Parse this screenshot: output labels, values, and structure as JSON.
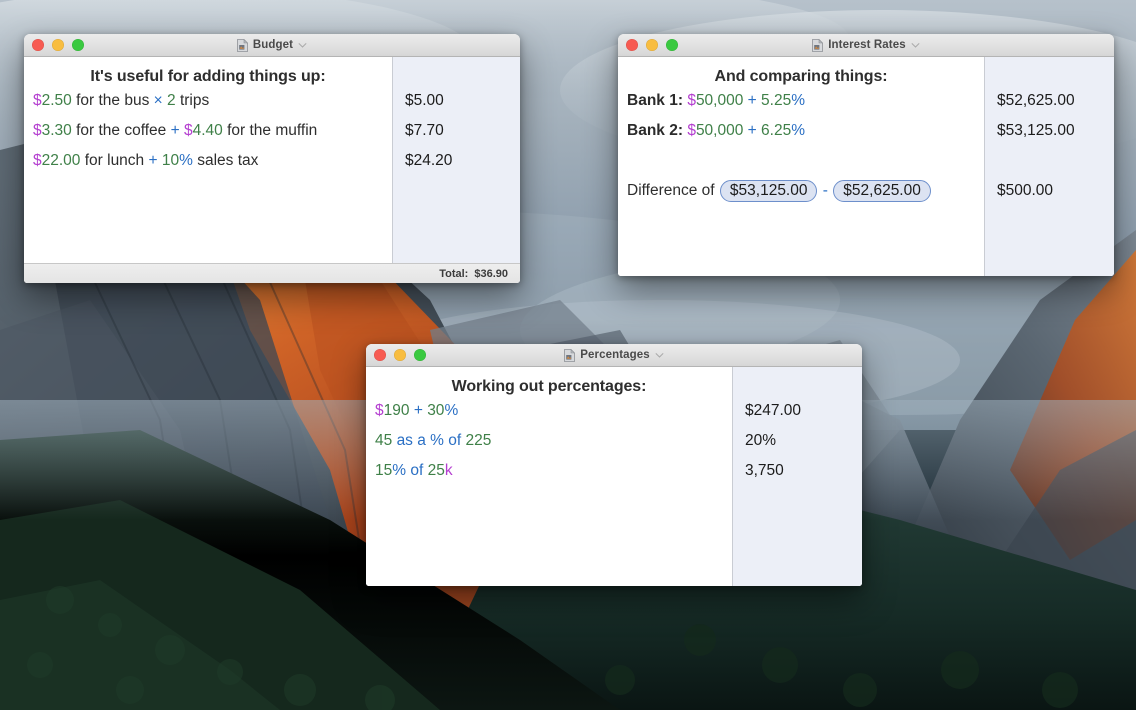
{
  "desktop": {
    "wallpaper_name": "yosemite-valley-wallpaper",
    "colors": {
      "sky_top": "#b9c3cc",
      "sky_mid": "#8fa0ac",
      "rock_lit": "#c8551f",
      "rock_shadow": "#3f4a55",
      "forest": "#16301f",
      "valley_dark": "#0e1a18"
    }
  },
  "token_colors": {
    "number": "#3f8048",
    "currency": "#b43fd0",
    "operator": "#2a6fc4",
    "plain_text": "#2e2e2e",
    "pill_fill": "#dce3f2",
    "pill_border": "#6d8fcb"
  },
  "traffic_lights": {
    "close_label": "close",
    "minimize_label": "minimize",
    "zoom_label": "zoom",
    "close_color": "#f75b52",
    "minimize_color": "#f8bd40",
    "zoom_color": "#3ac940"
  },
  "windows": [
    {
      "id": "budget",
      "title": "Budget",
      "heading": "It's useful for adding things up:",
      "rows": [
        {
          "tokens": [
            {
              "text": "$",
              "type": "currency"
            },
            {
              "text": "2.50",
              "type": "number"
            },
            {
              "text": " for the bus ",
              "type": "plain"
            },
            {
              "text": "×",
              "type": "operator"
            },
            {
              "text": " ",
              "type": "plain"
            },
            {
              "text": "2",
              "type": "number"
            },
            {
              "text": " trips",
              "type": "plain"
            }
          ],
          "result": "$5.00"
        },
        {
          "tokens": [
            {
              "text": "$",
              "type": "currency"
            },
            {
              "text": "3.30",
              "type": "number"
            },
            {
              "text": " for the coffee ",
              "type": "plain"
            },
            {
              "text": "+",
              "type": "operator"
            },
            {
              "text": " ",
              "type": "plain"
            },
            {
              "text": "$",
              "type": "currency"
            },
            {
              "text": "4.40",
              "type": "number"
            },
            {
              "text": " for the muffin",
              "type": "plain"
            }
          ],
          "result": "$7.70"
        },
        {
          "tokens": [
            {
              "text": "$",
              "type": "currency"
            },
            {
              "text": "22.00",
              "type": "number"
            },
            {
              "text": " for lunch ",
              "type": "plain"
            },
            {
              "text": "+",
              "type": "operator"
            },
            {
              "text": " ",
              "type": "plain"
            },
            {
              "text": "10",
              "type": "number"
            },
            {
              "text": "%",
              "type": "operator"
            },
            {
              "text": " sales tax",
              "type": "plain"
            }
          ],
          "result": "$24.20"
        }
      ],
      "statusbar": {
        "label": "Total:",
        "value": "$36.90"
      }
    },
    {
      "id": "interest",
      "title": "Interest Rates",
      "heading": "And comparing things:",
      "rows": [
        {
          "tokens": [
            {
              "text": "Bank 1:",
              "type": "label"
            },
            {
              "text": " ",
              "type": "plain"
            },
            {
              "text": "$",
              "type": "currency"
            },
            {
              "text": "50,000",
              "type": "number"
            },
            {
              "text": " ",
              "type": "plain"
            },
            {
              "text": "+",
              "type": "operator"
            },
            {
              "text": " ",
              "type": "plain"
            },
            {
              "text": "5.25",
              "type": "number"
            },
            {
              "text": "%",
              "type": "operator"
            }
          ],
          "result": "$52,625.00"
        },
        {
          "tokens": [
            {
              "text": "Bank 2:",
              "type": "label"
            },
            {
              "text": " ",
              "type": "plain"
            },
            {
              "text": "$",
              "type": "currency"
            },
            {
              "text": "50,000",
              "type": "number"
            },
            {
              "text": " ",
              "type": "plain"
            },
            {
              "text": "+",
              "type": "operator"
            },
            {
              "text": " ",
              "type": "plain"
            },
            {
              "text": "6.25",
              "type": "number"
            },
            {
              "text": "%",
              "type": "operator"
            }
          ],
          "result": "$53,125.00"
        },
        {
          "spacer": true,
          "tokens": [],
          "result": ""
        },
        {
          "tokens": [
            {
              "text": "Difference of ",
              "type": "plain"
            },
            {
              "text": "$53,125.00",
              "type": "pill"
            },
            {
              "text": " ",
              "type": "plain"
            },
            {
              "text": "-",
              "type": "operator"
            },
            {
              "text": " ",
              "type": "plain"
            },
            {
              "text": "$52,625.00",
              "type": "pill"
            }
          ],
          "result": "$500.00"
        }
      ]
    },
    {
      "id": "percent",
      "title": "Percentages",
      "heading": "Working out percentages:",
      "rows": [
        {
          "tokens": [
            {
              "text": "$",
              "type": "currency"
            },
            {
              "text": "190",
              "type": "number"
            },
            {
              "text": " ",
              "type": "plain"
            },
            {
              "text": "+",
              "type": "operator"
            },
            {
              "text": " ",
              "type": "plain"
            },
            {
              "text": "30",
              "type": "number"
            },
            {
              "text": "%",
              "type": "operator"
            }
          ],
          "result": "$247.00"
        },
        {
          "tokens": [
            {
              "text": "45",
              "type": "number"
            },
            {
              "text": " ",
              "type": "plain"
            },
            {
              "text": "as a % of",
              "type": "operator"
            },
            {
              "text": " ",
              "type": "plain"
            },
            {
              "text": "225",
              "type": "number"
            }
          ],
          "result": "20%"
        },
        {
          "tokens": [
            {
              "text": "15",
              "type": "number"
            },
            {
              "text": "%",
              "type": "operator"
            },
            {
              "text": " ",
              "type": "plain"
            },
            {
              "text": "of",
              "type": "operator"
            },
            {
              "text": " ",
              "type": "plain"
            },
            {
              "text": "25",
              "type": "number"
            },
            {
              "text": "k",
              "type": "unit"
            }
          ],
          "result": "3,750"
        }
      ]
    }
  ]
}
